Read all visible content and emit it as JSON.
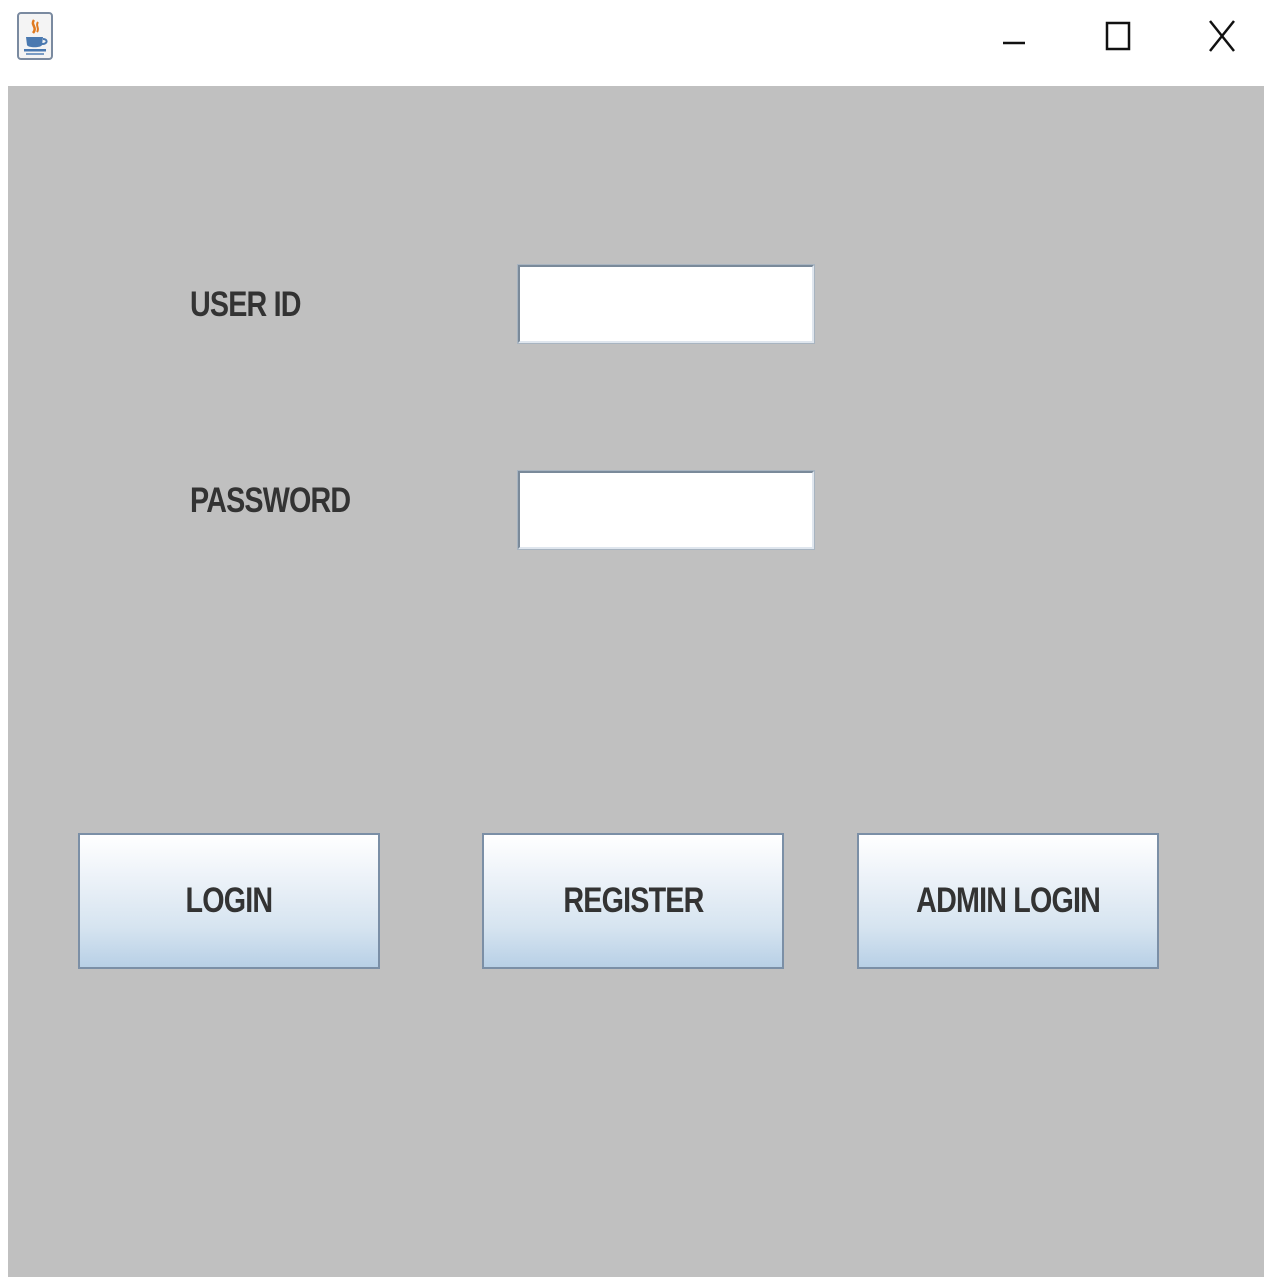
{
  "titlebar": {
    "app_icon": "java-coffee-icon",
    "minimize_icon": "minimize-icon",
    "maximize_icon": "maximize-icon",
    "close_icon": "close-icon"
  },
  "form": {
    "user_id_label": "USER ID",
    "user_id_value": "",
    "password_label": "PASSWORD",
    "password_value": ""
  },
  "buttons": {
    "login": "LOGIN",
    "register": "REGISTER",
    "admin_login": "ADMIN LOGIN"
  },
  "colors": {
    "panel_background": "#c0c0c0",
    "button_gradient_top": "#ffffff",
    "button_gradient_bottom": "#b8d0e6",
    "text": "#333333"
  }
}
